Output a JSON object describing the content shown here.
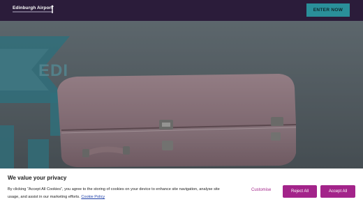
{
  "header": {
    "logo_text": "Edinburgh Airport",
    "logo_icon": "control-tower-icon",
    "enter_button": "ENTER NOW"
  },
  "hero": {
    "graphic_text": "EDI",
    "image": "pink-suitcase"
  },
  "cookie_banner": {
    "title": "We value your privacy",
    "body_line1": "By clicking “Accept All Cookies”, you agree to the storing of cookies on your device to enhance site navigation, analyse site",
    "body_line2": "usage, and assist in our marketing efforts.",
    "policy_link": "Cookie Policy",
    "customise_label": "Customise",
    "reject_label": "Reject All",
    "accept_label": "Accept All"
  },
  "colors": {
    "header_bg": "#2b1c3a",
    "enter_button_bg": "#2a8f9a",
    "brand_magenta": "#a3248a",
    "link_blue": "#1d3fa8"
  }
}
